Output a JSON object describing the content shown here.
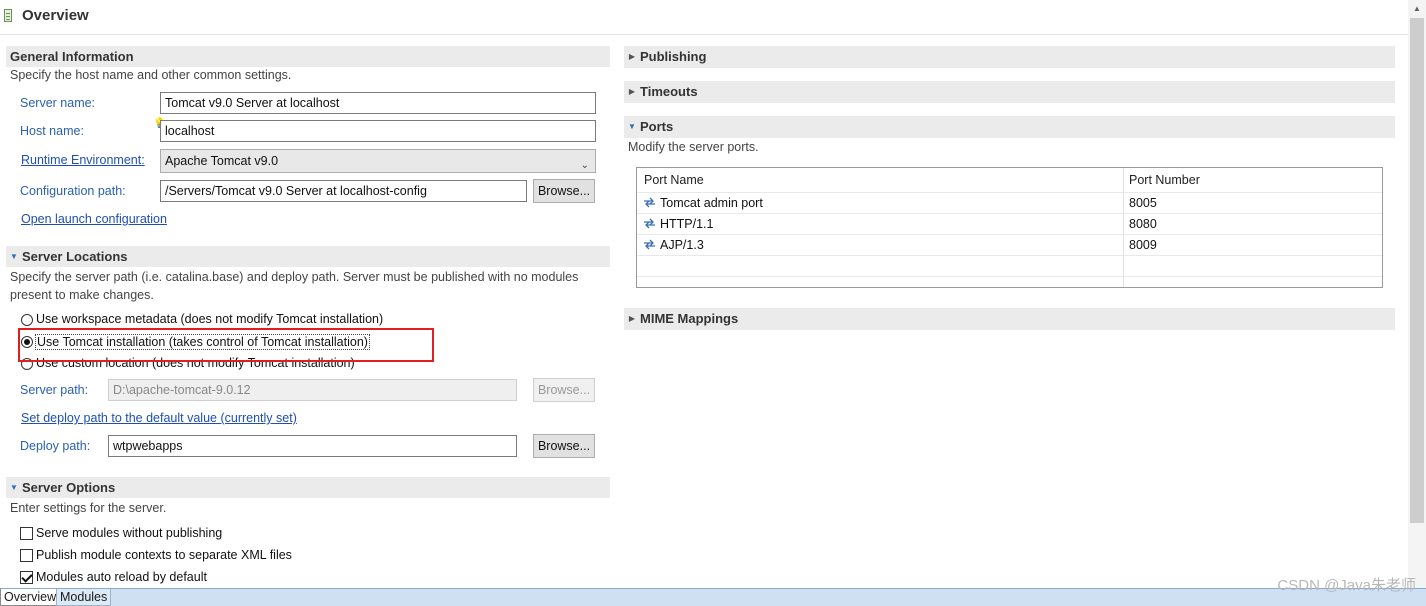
{
  "header": {
    "title": "Overview"
  },
  "general": {
    "title": "General Information",
    "description": "Specify the host name and other common settings.",
    "server_name_label": "Server name:",
    "server_name_value": "Tomcat v9.0 Server at localhost",
    "host_name_label": "Host name:",
    "host_name_value": "localhost",
    "runtime_label": "Runtime Environment:",
    "runtime_value": "Apache Tomcat v9.0",
    "config_path_label": "Configuration path:",
    "config_path_value": "/Servers/Tomcat v9.0 Server at localhost-config",
    "browse_label": "Browse...",
    "open_launch_label": "Open launch configuration"
  },
  "locations": {
    "title": "Server Locations",
    "description_line1": "Specify the server path (i.e. catalina.base) and deploy path. Server must be published with no modules",
    "description_line2": "present to make changes.",
    "options": [
      "Use workspace metadata (does not modify Tomcat installation)",
      "Use Tomcat installation (takes control of Tomcat installation)",
      "Use custom location (does not modify Tomcat installation)"
    ],
    "selected_index": 1,
    "server_path_label": "Server path:",
    "server_path_value": "D:\\apache-tomcat-9.0.12",
    "browse_label": "Browse...",
    "set_deploy_label": "Set deploy path to the default value (currently set)",
    "deploy_path_label": "Deploy path:",
    "deploy_path_value": "wtpwebapps"
  },
  "options": {
    "title": "Server Options",
    "description": "Enter settings for the server.",
    "items": [
      {
        "label": "Serve modules without publishing",
        "checked": false
      },
      {
        "label": "Publish module contexts to separate XML files",
        "checked": false
      },
      {
        "label": "Modules auto reload by default",
        "checked": true
      }
    ]
  },
  "right": {
    "publishing": "Publishing",
    "timeouts": "Timeouts",
    "ports_title": "Ports",
    "ports_description": "Modify the server ports.",
    "ports_columns": [
      "Port Name",
      "Port Number"
    ],
    "ports_rows": [
      {
        "name": "Tomcat admin port",
        "number": "8005"
      },
      {
        "name": "HTTP/1.1",
        "number": "8080"
      },
      {
        "name": "AJP/1.3",
        "number": "8009"
      }
    ],
    "mime": "MIME Mappings"
  },
  "tabs": [
    "Overview",
    "Modules"
  ],
  "watermark": "CSDN @Java朱老师",
  "colors": {
    "highlight": "#e02020",
    "link": "#1f4fb0",
    "section_bar": "#ebebeb"
  }
}
